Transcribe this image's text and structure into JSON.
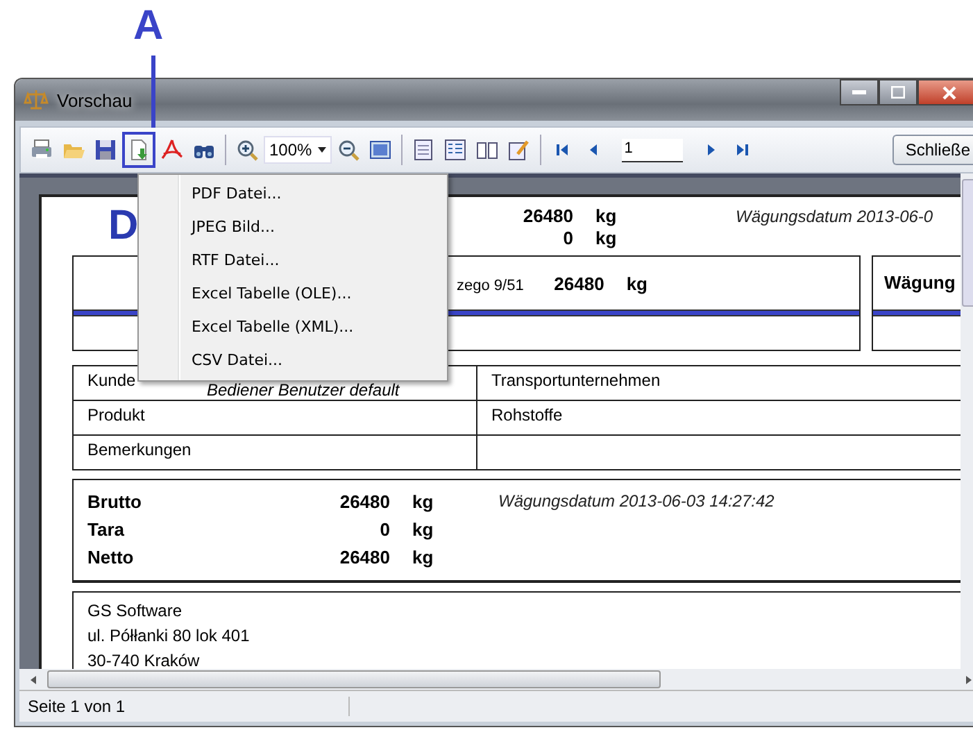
{
  "callout": {
    "label": "A"
  },
  "window": {
    "title": "Vorschau"
  },
  "toolbar": {
    "export_expanded": true,
    "zoom": "100%",
    "page": "1",
    "close_button": "Schließe"
  },
  "export_menu": [
    {
      "label": "PDF Datei..."
    },
    {
      "label": "JPEG Bild..."
    },
    {
      "label": "RTF Datei..."
    },
    {
      "label": "Excel Tabelle (OLE)..."
    },
    {
      "label": "Excel Tabelle (XML)..."
    },
    {
      "label": "CSV Datei..."
    }
  ],
  "report": {
    "logo": "D",
    "header_rows": [
      {
        "value": "26480",
        "unit": "kg",
        "note": "Wägungsdatum 2013-06-0"
      },
      {
        "value": "0",
        "unit": "kg",
        "note": ""
      }
    ],
    "address_fragment": "zego 9/51",
    "header_value": "26480",
    "header_unit": "kg",
    "side_heading": "Wägung",
    "info_rows": [
      {
        "label": "Kunde",
        "overlay": "Bediener Benutzer default",
        "value": "Transportunternehmen"
      },
      {
        "label": "Produkt",
        "value": "Rohstoffe"
      },
      {
        "label": "Bemerkungen",
        "value": ""
      }
    ],
    "weights": [
      {
        "label": "Brutto",
        "value": "26480",
        "unit": "kg"
      },
      {
        "label": "Tara",
        "value": "0",
        "unit": "kg"
      },
      {
        "label": "Netto",
        "value": "26480",
        "unit": "kg"
      }
    ],
    "weigh_date": "Wägungsdatum 2013-06-03 14:27:42",
    "company": [
      "GS Software",
      "ul. Półłanki 80 lok 401",
      "30-740 Kraków"
    ]
  },
  "status_bar": {
    "text": "Seite 1 von 1"
  }
}
